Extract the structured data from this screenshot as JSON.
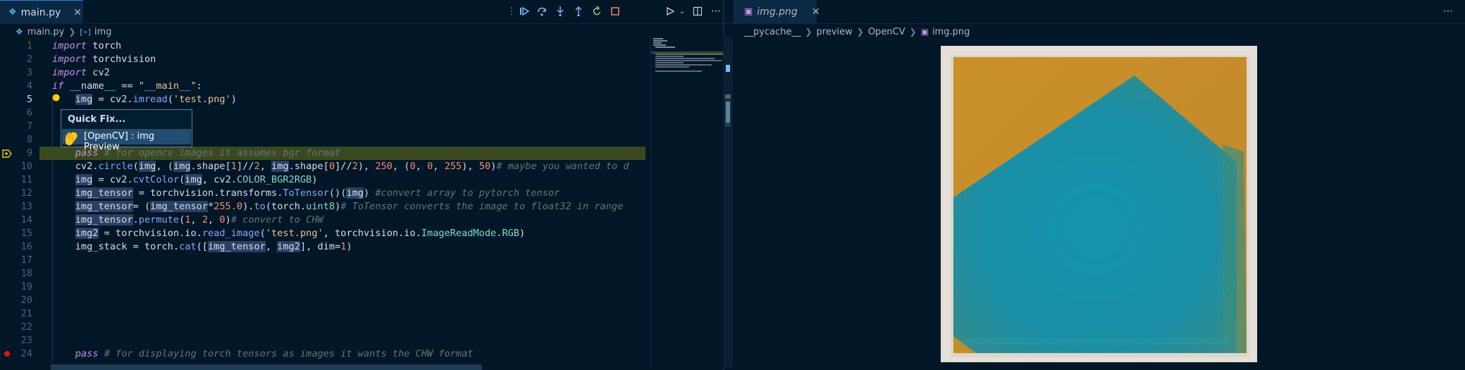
{
  "tabs": {
    "left": {
      "file_icon": "python-file-icon",
      "label": "main.py"
    },
    "right": {
      "file_icon": "image-file-icon",
      "label": "img.png"
    }
  },
  "breadcrumbs": {
    "left": [
      "main.py",
      "img"
    ],
    "right": [
      "__pycache__",
      "preview",
      "OpenCV",
      "img.png"
    ]
  },
  "debug_toolbar": [
    "drag-handle",
    "continue",
    "step-over",
    "step-into",
    "step-out",
    "restart",
    "stop"
  ],
  "quickfix": {
    "title": "Quick Fix...",
    "item": "[OpenCV] : img Preview"
  },
  "code_lines": [
    {
      "n": "1",
      "text": "import torch"
    },
    {
      "n": "2",
      "text": "import torchvision"
    },
    {
      "n": "3",
      "text": "import cv2"
    },
    {
      "n": "4",
      "text": "if __name__ == \"__main__\":"
    },
    {
      "n": "5",
      "text": "    img = cv2.imread('test.png')"
    },
    {
      "n": "6",
      "text": ""
    },
    {
      "n": "7",
      "text": ""
    },
    {
      "n": "8",
      "text": ""
    },
    {
      "n": "9",
      "text": "    pass # for opencv images it assumes bgr format"
    },
    {
      "n": "10",
      "text": "    cv2.circle(img, (img.shape[1]//2, img.shape[0]//2), 250, (0, 0, 255), 50)# maybe you wanted to d"
    },
    {
      "n": "11",
      "text": "    img = cv2.cvtColor(img, cv2.COLOR_BGR2RGB)"
    },
    {
      "n": "12",
      "text": "    img_tensor = torchvision.transforms.ToTensor()(img) #convert array to pytorch tensor"
    },
    {
      "n": "13",
      "text": "    img_tensor= (img_tensor*255.0).to(torch.uint8)# ToTensor converts the image to float32 in range"
    },
    {
      "n": "14",
      "text": "    img_tensor.permute(1, 2, 0)# convert to CHW"
    },
    {
      "n": "15",
      "text": "    img2 = torchvision.io.read_image('test.png', torchvision.io.ImageReadMode.RGB)"
    },
    {
      "n": "16",
      "text": "    img_stack = torch.cat([img_tensor, img2], dim=1)"
    },
    {
      "n": "17",
      "text": ""
    },
    {
      "n": "18",
      "text": ""
    },
    {
      "n": "19",
      "text": ""
    },
    {
      "n": "20",
      "text": ""
    },
    {
      "n": "21",
      "text": ""
    },
    {
      "n": "22",
      "text": ""
    },
    {
      "n": "23",
      "text": ""
    },
    {
      "n": "24",
      "text": "    pass # for displaying torch tensors as images it wants the CHW format"
    }
  ],
  "colors": {
    "accent": "#2d7de0",
    "breakpoint": "#e51400",
    "debug_line": "#3a4a1e"
  }
}
